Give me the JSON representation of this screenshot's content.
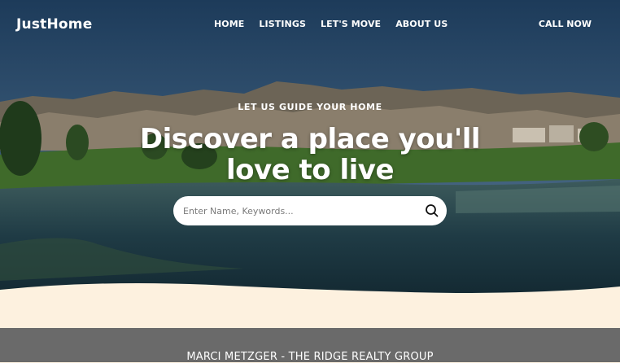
{
  "brand": {
    "name": "JustHome"
  },
  "nav": {
    "items": [
      {
        "label": "HOME"
      },
      {
        "label": "LISTINGS"
      },
      {
        "label": "LET'S MOVE"
      },
      {
        "label": "ABOUT US"
      }
    ],
    "cta_label": "CALL NOW"
  },
  "hero": {
    "eyebrow": "LET US GUIDE YOUR HOME",
    "headline_line1": "Discover a place you'll",
    "headline_line2": "love to live"
  },
  "search": {
    "placeholder": "Enter Name, Keywords...",
    "value": "",
    "icon": "search-icon"
  },
  "band": {
    "title": "MARCI METZGER - THE RIDGE REALTY GROUP"
  },
  "colors": {
    "cream": "#fdf1df",
    "band": "#6a6a6a",
    "text_light": "#ffffff"
  }
}
